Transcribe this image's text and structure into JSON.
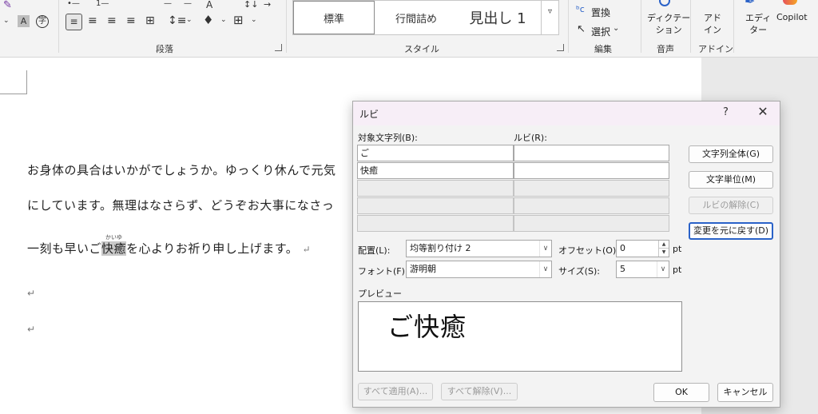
{
  "ribbon": {
    "paragraph_group": "段落",
    "style_group": "スタイル",
    "edit_group": "編集",
    "voice_group": "音声",
    "addin_group": "アドイン",
    "styles": [
      "標準",
      "行間詰め",
      "見出し 1"
    ],
    "replace": "置換",
    "select": "選択",
    "select_arrow": "⌄",
    "dictation": "ディクテー\nション",
    "addin": "アド\nイン",
    "editor": "エディ\nター",
    "copilot": "Copilot"
  },
  "document": {
    "line1": "お身体の具合はいかがでしょうか。ゆっくり休んで元気",
    "line2": "にしています。無理はなさらず、どうぞお大事になさっ",
    "line3_before": "一刻も早いご",
    "line3_highlight": "快癒",
    "line3_ruby": "かいゆ",
    "line3_after": "を心よりお祈り申し上げます。",
    "para_mark": "↵"
  },
  "dialog": {
    "title": "ルビ",
    "help": "?",
    "close": "✕",
    "target_label": "対象文字列(B):",
    "ruby_label": "ルビ(R):",
    "rows": [
      {
        "target": "ご",
        "ruby": ""
      },
      {
        "target": "快癒",
        "ruby": ""
      },
      {
        "target": "",
        "ruby": ""
      },
      {
        "target": "",
        "ruby": ""
      },
      {
        "target": "",
        "ruby": ""
      }
    ],
    "btn_whole": "文字列全体(G)",
    "btn_char": "文字単位(M)",
    "btn_remove": "ルビの解除(C)",
    "btn_revert": "変更を元に戻す(D)",
    "alignment_label": "配置(L):",
    "alignment_value": "均等割り付け 2",
    "offset_label": "オフセット(O):",
    "offset_value": "0",
    "offset_unit": "pt",
    "font_label": "フォント(F):",
    "font_value": "游明朝",
    "size_label": "サイズ(S):",
    "size_value": "5",
    "size_unit": "pt",
    "preview_label": "プレビュー",
    "preview_text": "ご快癒",
    "apply_all": "すべて適用(A)...",
    "clear_all": "すべて解除(V)...",
    "ok": "OK",
    "cancel": "キャンセル"
  }
}
